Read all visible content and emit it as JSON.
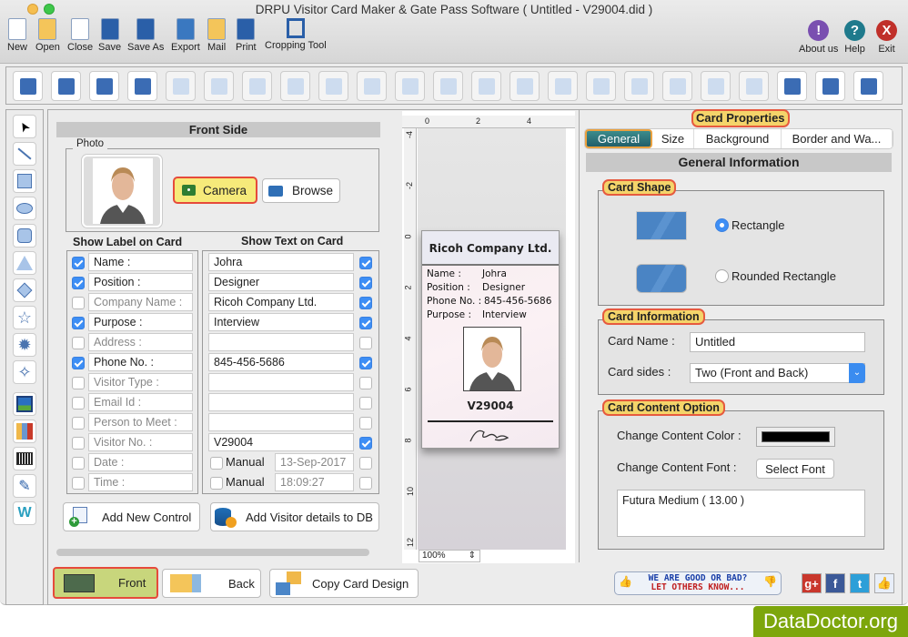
{
  "window": {
    "title": "DRPU Visitor Card Maker & Gate Pass Software ( Untitled - V29004.did )"
  },
  "main_toolbar": {
    "left": [
      {
        "label": "New",
        "icon": "new-document-icon"
      },
      {
        "label": "Open",
        "icon": "open-folder-icon"
      },
      {
        "label": "Close",
        "icon": "close-document-icon"
      },
      {
        "label": "Save",
        "icon": "save-icon"
      },
      {
        "label": "Save As",
        "icon": "save-as-icon"
      },
      {
        "label": "Export",
        "icon": "export-icon"
      },
      {
        "label": "Mail",
        "icon": "mail-icon"
      },
      {
        "label": "Print",
        "icon": "print-icon"
      },
      {
        "label": "Cropping Tool",
        "icon": "crop-icon"
      }
    ],
    "right": [
      {
        "label": "About us",
        "icon": "about-icon",
        "glyph": "!",
        "color": "#7a4fb0"
      },
      {
        "label": "Help",
        "icon": "help-icon",
        "glyph": "?",
        "color": "#1f7a8c"
      },
      {
        "label": "Exit",
        "icon": "exit-icon",
        "glyph": "X",
        "color": "#c0302a"
      }
    ]
  },
  "edit_toolbar": [
    {
      "name": "properties",
      "enabled": true
    },
    {
      "name": "insert-image",
      "enabled": true
    },
    {
      "name": "export-image",
      "enabled": true
    },
    {
      "name": "undo",
      "enabled": true
    },
    {
      "name": "redo",
      "enabled": false
    },
    {
      "name": "cut",
      "enabled": false
    },
    {
      "name": "copy",
      "enabled": false
    },
    {
      "name": "paste",
      "enabled": false
    },
    {
      "name": "delete",
      "enabled": false
    },
    {
      "name": "bring-front",
      "enabled": false
    },
    {
      "name": "send-back",
      "enabled": false
    },
    {
      "name": "lock",
      "enabled": false
    },
    {
      "name": "unlock",
      "enabled": false
    },
    {
      "name": "move-left",
      "enabled": false
    },
    {
      "name": "move-right",
      "enabled": false
    },
    {
      "name": "move-up",
      "enabled": false
    },
    {
      "name": "move-down",
      "enabled": false
    },
    {
      "name": "center",
      "enabled": false
    },
    {
      "name": "center-horizontal",
      "enabled": false
    },
    {
      "name": "center-vertical",
      "enabled": false
    },
    {
      "name": "grid",
      "enabled": true
    },
    {
      "name": "ruler",
      "enabled": true
    },
    {
      "name": "preview-card",
      "enabled": true
    }
  ],
  "drawing_tools": [
    "pointer",
    "line",
    "rectangle",
    "ellipse",
    "rounded-rectangle",
    "triangle",
    "diamond",
    "star",
    "burst",
    "four-point-star",
    "image",
    "library",
    "barcode",
    "signature",
    "watermark"
  ],
  "front_panel": {
    "header": "Front Side",
    "photo_legend": "Photo",
    "camera_label": "Camera",
    "browse_label": "Browse",
    "show_label_header": "Show Label on Card",
    "show_text_header": "Show Text on Card",
    "rows": [
      {
        "label": "Name :",
        "label_checked": true,
        "value": "Johra",
        "value_checked": true
      },
      {
        "label": "Position :",
        "label_checked": true,
        "value": "Designer",
        "value_checked": true
      },
      {
        "label": "Company Name :",
        "label_checked": false,
        "value": "Ricoh Company Ltd.",
        "value_checked": true
      },
      {
        "label": "Purpose :",
        "label_checked": true,
        "value": "Interview",
        "value_checked": true
      },
      {
        "label": "Address :",
        "label_checked": false,
        "value": "",
        "value_checked": false
      },
      {
        "label": "Phone No. :",
        "label_checked": true,
        "value": "845-456-5686",
        "value_checked": true
      },
      {
        "label": "Visitor Type :",
        "label_checked": false,
        "value": "",
        "value_checked": false
      },
      {
        "label": "Email Id :",
        "label_checked": false,
        "value": "",
        "value_checked": false
      },
      {
        "label": "Person to Meet :",
        "label_checked": false,
        "value": "",
        "value_checked": false
      },
      {
        "label": "Visitor No. :",
        "label_checked": false,
        "value": "V29004",
        "value_checked": true
      }
    ],
    "date": {
      "label": "Date :",
      "manual_label": "Manual",
      "value": "13-Sep-2017"
    },
    "time": {
      "label": "Time :",
      "manual_label": "Manual",
      "value": "18:09:27"
    },
    "add_control_label": "Add New Control",
    "add_db_label": "Add Visitor details to DB"
  },
  "canvas": {
    "ruler_top": [
      "0",
      "2",
      "4"
    ],
    "ruler_left": [
      "-4",
      "-2",
      "0",
      "2",
      "4",
      "6",
      "8",
      "10",
      "12"
    ],
    "zoom": "100%",
    "card": {
      "company": "Ricoh Company Ltd.",
      "fields": [
        {
          "label": "Name :",
          "value": "Johra"
        },
        {
          "label": "Position :",
          "value": "Designer"
        },
        {
          "label": "Phone No. :",
          "value": "845-456-5686"
        },
        {
          "label": "Purpose :",
          "value": "Interview"
        }
      ],
      "visitor_no": "V29004"
    }
  },
  "properties": {
    "title": "Card Properties",
    "tabs": [
      "General",
      "Size",
      "Background",
      "Border and Wa..."
    ],
    "active_tab": "General",
    "section_header": "General Information",
    "card_shape": {
      "legend": "Card Shape",
      "options": [
        "Rectangle",
        "Rounded Rectangle"
      ],
      "selected": "Rectangle"
    },
    "card_info": {
      "legend": "Card Information",
      "name_label": "Card Name :",
      "name_value": "Untitled",
      "sides_label": "Card sides :",
      "sides_value": "Two (Front and Back)"
    },
    "content_option": {
      "legend": "Card Content Option",
      "color_label": "Change Content Color :",
      "color_value": "#000000",
      "font_label": "Change Content Font :",
      "font_button": "Select Font",
      "font_value": "Futura Medium ( 13.00 )"
    }
  },
  "bottom": {
    "front_label": "Front",
    "back_label": "Back",
    "copy_label": "Copy Card Design",
    "feedback_line1": "WE ARE GOOD OR BAD?",
    "feedback_line2": "LET OTHERS KNOW...",
    "social": [
      {
        "name": "google-plus",
        "glyph": "g+",
        "color": "#c9372c"
      },
      {
        "name": "facebook",
        "glyph": "f",
        "color": "#3b5998"
      },
      {
        "name": "twitter",
        "glyph": "t",
        "color": "#2d9fd8"
      },
      {
        "name": "like",
        "glyph": "👍",
        "color": "#e8eef8"
      }
    ]
  },
  "watermark": "DataDoctor.org"
}
